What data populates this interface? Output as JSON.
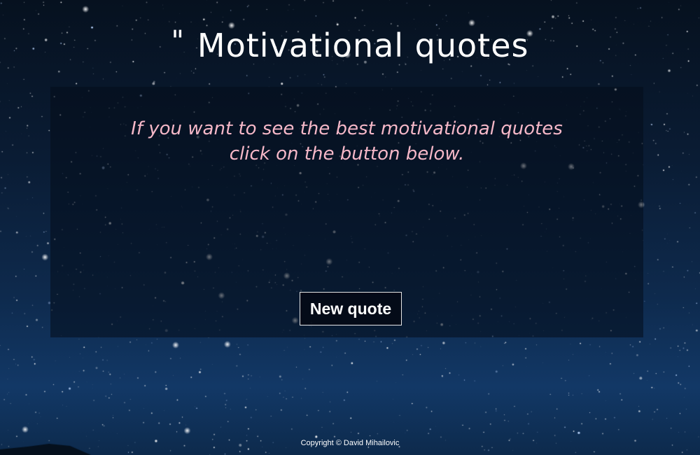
{
  "header": {
    "quote_mark": "\"",
    "title": "Motivational quotes"
  },
  "quote_box": {
    "line1": "If you want to see the best motivational quotes",
    "line2": "click on the button below."
  },
  "button": {
    "label": "New quote"
  },
  "footer": {
    "copyright": "Copyright © David Mihailovic"
  },
  "colors": {
    "quote_text": "#f6b8c8",
    "title": "#ffffff",
    "background": "#0e2a4d"
  }
}
